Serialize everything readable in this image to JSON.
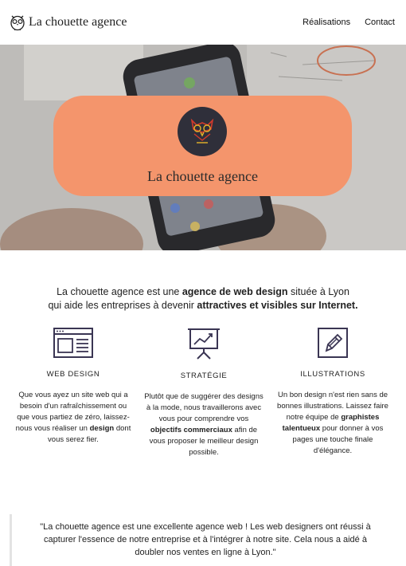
{
  "header": {
    "brand_name": "La chouette agence",
    "nav": [
      "Réalisations",
      "Contact"
    ]
  },
  "hero": {
    "card_title": "La chouette agence",
    "card_color": "#f4956c",
    "badge_color": "#2f2f3a"
  },
  "intro": {
    "line1_pre": "La chouette agence est une ",
    "line1_bold": "agence de web design",
    "line1_post": " située à Lyon",
    "line2_pre": "qui aide les entreprises à devenir ",
    "line2_bold": "attractives et visibles sur Internet."
  },
  "services": [
    {
      "icon": "web-layout-icon",
      "heading": "WEB DESIGN",
      "t1": "Que vous ayez un site web qui a besoin d'un rafraîchissement ou que vous partiez de zéro, laissez-nous vous réaliser un ",
      "b1": "design",
      "t2": " dont vous serez fier.",
      "b2": "",
      "t3": ""
    },
    {
      "icon": "presentation-chart-icon",
      "heading": "STRATÉGIE",
      "t1": "Plutôt que de suggérer des designs à la mode, nous travaillerons avec vous pour comprendre vos ",
      "b1": "objectifs commerciaux",
      "t2": " afin de vous proposer le meilleur design possible.",
      "b2": "",
      "t3": ""
    },
    {
      "icon": "pencil-icon",
      "heading": "ILLUSTRATIONS",
      "t1": "Un bon design n'est rien sans de bonnes illustrations. Laissez faire notre équipe de ",
      "b1": "graphistes talentueux",
      "t2": " pour donner à vos pages une touche finale d'élégance.",
      "b2": "",
      "t3": ""
    }
  ],
  "testimonial": {
    "text": "\"La chouette agence est une excellente agence web ! Les web designers ont réussi à capturer l'essence de notre entreprise et à l'intégrer à notre site. Cela nous a aidé à doubler nos ventes en ligne à Lyon.\""
  },
  "colors": {
    "accent": "#f4956c",
    "icon_stroke": "#3a3553",
    "owl_red": "#d23a2c",
    "owl_yellow": "#e6b52a"
  }
}
